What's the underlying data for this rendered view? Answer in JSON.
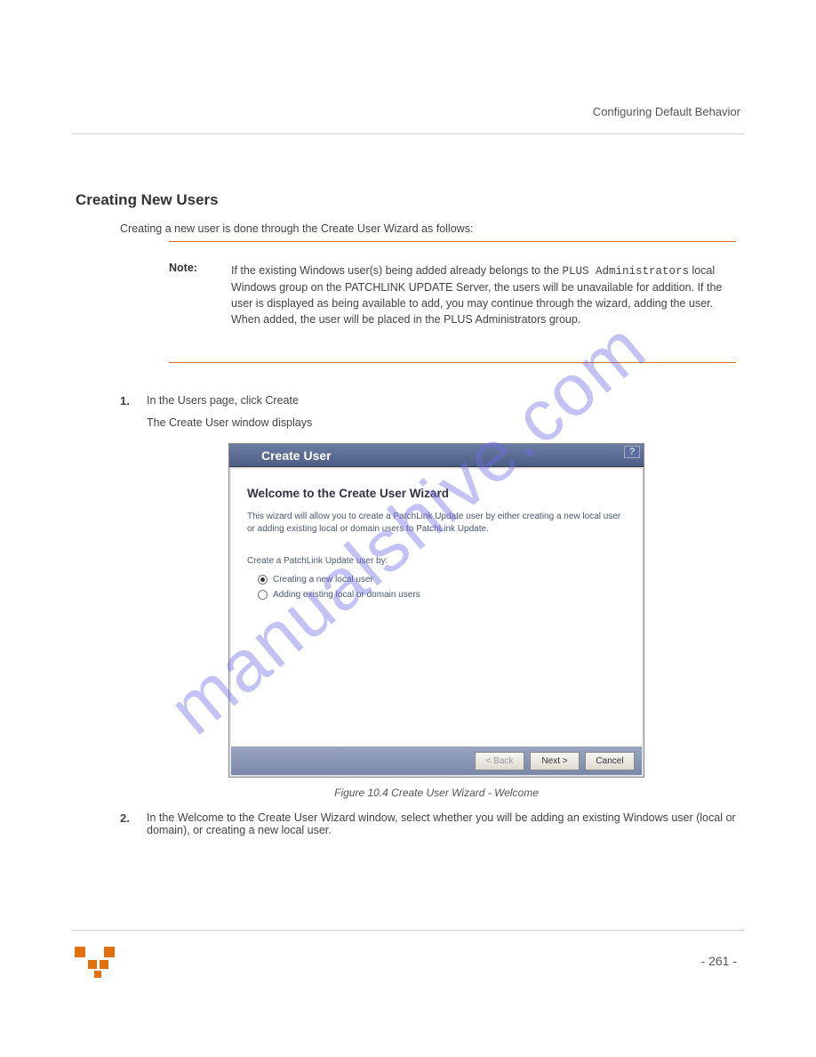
{
  "header": {
    "breadcrumb": "Configuring Default Behavior"
  },
  "section_title": "Creating New Users",
  "intro": "Creating a new user is done through the Create User Wizard as follows:",
  "note": {
    "label": "Note:",
    "body_1": "If the existing Windows user(s) being added already belongs to the ",
    "body_code": "PLUS Administrators",
    "body_2": " local Windows group on the PATCHLINK UPDATE Server, the users will be unavailable for addition. If the user is displayed as being available to add, you may continue through the wizard, adding the user. When added, the user will be placed in the PLUS Administrators group."
  },
  "step1": {
    "num": "1.",
    "text": "In the Users page, click Create",
    "result": "The Create User window displays"
  },
  "dialog": {
    "title": "Create User",
    "heading": "Welcome to the Create User Wizard",
    "description": "This wizard will allow you to create a PatchLink Update user by either creating a new local user or adding existing local or domain users to PatchLink Update.",
    "subprompt": "Create a PatchLink Update user by:",
    "radio1": "Creating a new local user",
    "radio2": "Adding existing local or domain users",
    "btn_back": "< Back",
    "btn_next": "Next >",
    "btn_cancel": "Cancel",
    "help": "?"
  },
  "figure_caption": "Figure 10.4  Create User Wizard - Welcome",
  "step2": {
    "num": "2.",
    "text": "In the Welcome to the Create User Wizard window, select whether you will be adding an existing Windows user (local or domain), or creating a new local user."
  },
  "footer": {
    "page": "- 261 -"
  },
  "watermark": "manualshive.com"
}
